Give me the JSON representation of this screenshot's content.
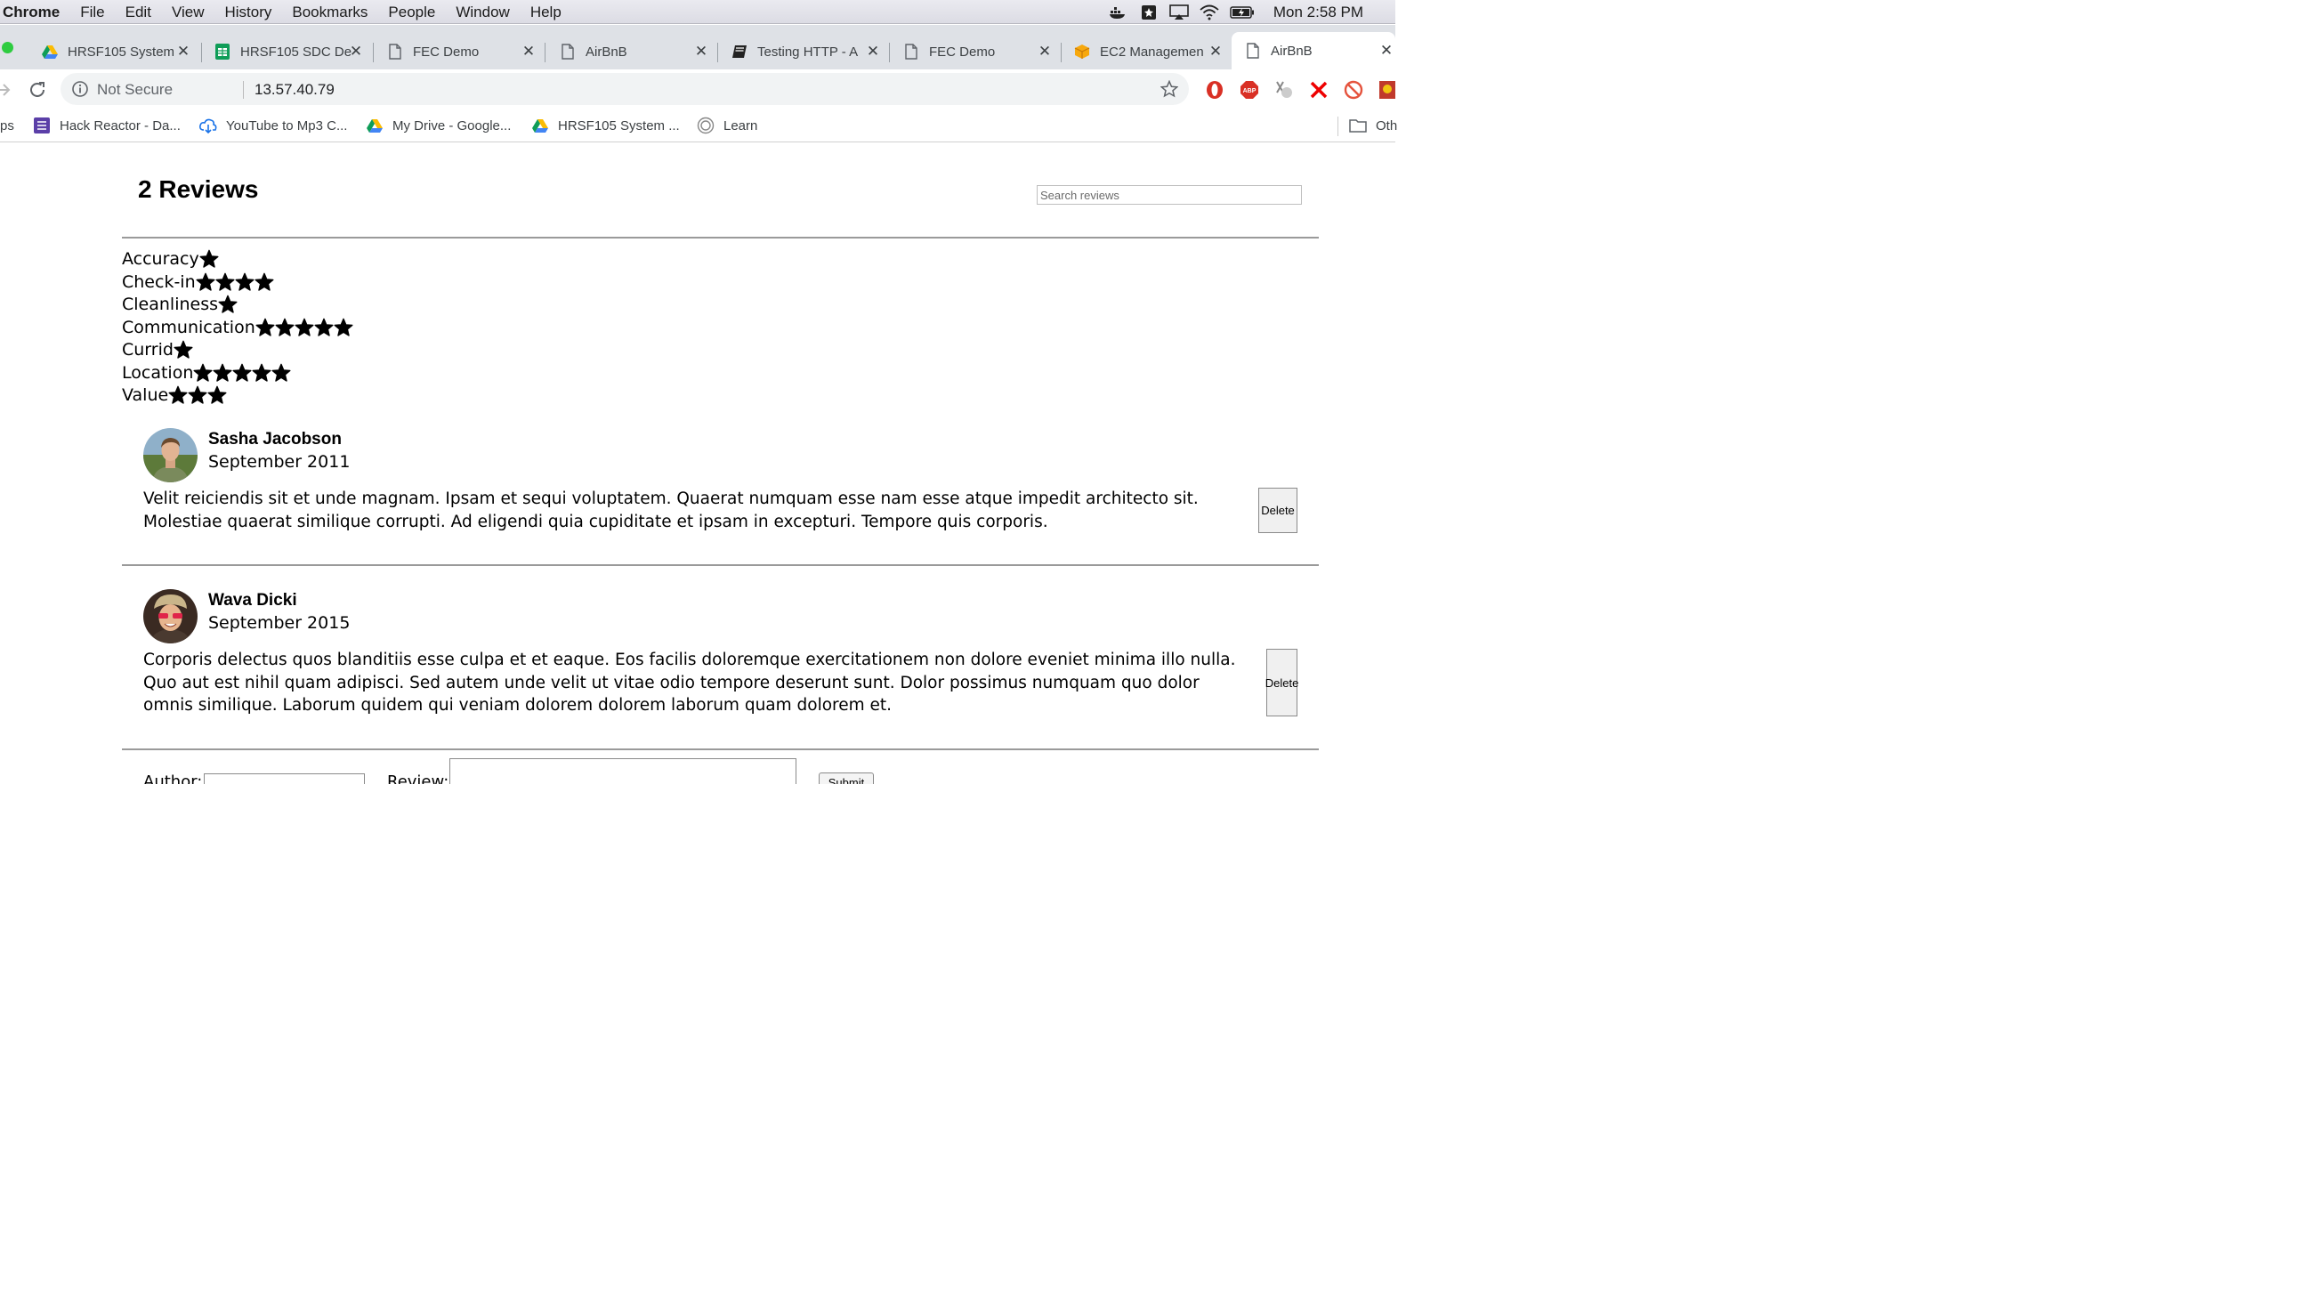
{
  "menubar": {
    "app_name": "Chrome",
    "menus": [
      "File",
      "Edit",
      "View",
      "History",
      "Bookmarks",
      "People",
      "Window",
      "Help"
    ],
    "clock": "Mon 2:58 PM"
  },
  "tabs": [
    {
      "title": "HRSF105 System",
      "icon": "google-drive-icon"
    },
    {
      "title": "HRSF105 SDC De",
      "icon": "google-sheets-icon"
    },
    {
      "title": "FEC Demo",
      "icon": "page-icon"
    },
    {
      "title": "AirBnB",
      "icon": "page-icon"
    },
    {
      "title": "Testing HTTP - A",
      "icon": "book-icon"
    },
    {
      "title": "FEC Demo",
      "icon": "page-icon"
    },
    {
      "title": "EC2 Managemen",
      "icon": "aws-icon"
    },
    {
      "title": "AirBnB",
      "icon": "page-icon",
      "active": true
    }
  ],
  "addressbar": {
    "security": "Not Secure",
    "url": "13.57.40.79"
  },
  "bookmarks": {
    "apps_fragment": "ps",
    "items": [
      {
        "label": "Hack Reactor - Da...",
        "icon": "hack-reactor-icon"
      },
      {
        "label": "YouTube to Mp3 C...",
        "icon": "cloud-download-icon"
      },
      {
        "label": "My Drive - Google...",
        "icon": "google-drive-icon"
      },
      {
        "label": "HRSF105 System ...",
        "icon": "google-drive-icon"
      },
      {
        "label": "Learn",
        "icon": "learn-icon"
      }
    ],
    "other_fragment": "Oth"
  },
  "page": {
    "title": "2 Reviews",
    "search_placeholder": "Search reviews",
    "ratings": [
      {
        "label": "Accuracy",
        "stars": 1
      },
      {
        "label": "Check-in",
        "stars": 4
      },
      {
        "label": "Cleanliness",
        "stars": 1
      },
      {
        "label": "Communication",
        "stars": 5
      },
      {
        "label": "Currid",
        "stars": 1
      },
      {
        "label": "Location",
        "stars": 5
      },
      {
        "label": "Value",
        "stars": 3
      }
    ],
    "reviews": [
      {
        "name": "Sasha Jacobson",
        "date": "September 2011",
        "text": "Velit reiciendis sit et unde magnam. Ipsam et sequi voluptatem. Quaerat numquam esse nam esse atque impedit architecto sit. Molestiae quaerat similique corrupti. Ad eligendi quia cupiditate et ipsam in excepturi. Tempore quis corporis.",
        "delete_label": "Delete"
      },
      {
        "name": "Wava Dicki",
        "date": "September 2015",
        "text": "Corporis delectus quos blanditiis esse culpa et et eaque. Eos facilis doloremque exercitationem non dolore eveniet minima illo nulla. Quo aut est nihil quam adipisci. Sed autem unde velit ut vitae odio tempore deserunt sunt. Dolor possimus numquam quo dolor omnis similique. Laborum quidem qui veniam dolorem dolorem laborum quam dolorem et.",
        "delete_label": "Delete"
      }
    ],
    "form": {
      "author_label": "Author:",
      "review_label": "Review:",
      "submit_label": "Submit"
    }
  }
}
